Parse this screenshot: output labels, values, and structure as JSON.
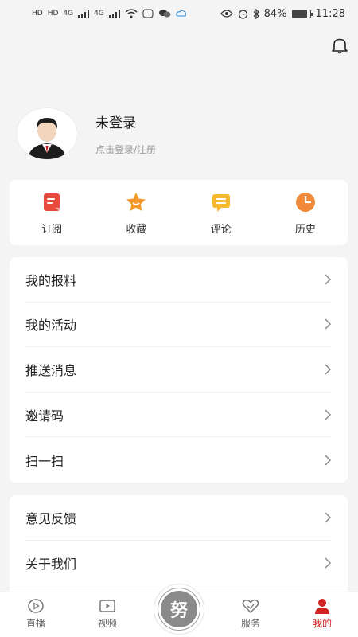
{
  "status_bar": {
    "left_labels": [
      "HD",
      "HD",
      "4G",
      "4G"
    ],
    "battery": "84%",
    "battery_level": 0.84,
    "time": "11:28"
  },
  "header": {
    "bell_icon": "bell-icon"
  },
  "profile": {
    "name": "未登录",
    "subtitle": "点击登录/注册"
  },
  "quick_actions": [
    {
      "label": "订阅",
      "icon": "subscribe-icon",
      "color": "#e84a3c"
    },
    {
      "label": "收藏",
      "icon": "favorite-star-icon",
      "color": "#f59a2a"
    },
    {
      "label": "评论",
      "icon": "comment-icon",
      "color": "#f5b82e"
    },
    {
      "label": "历史",
      "icon": "history-clock-icon",
      "color": "#f08a3a"
    }
  ],
  "menu_primary": [
    {
      "label": "我的报料"
    },
    {
      "label": "我的活动"
    },
    {
      "label": "推送消息"
    },
    {
      "label": "邀请码"
    },
    {
      "label": "扫一扫"
    }
  ],
  "menu_secondary": [
    {
      "label": "意见反馈"
    },
    {
      "label": "关于我们"
    }
  ],
  "bottom_nav": {
    "items": [
      {
        "label": "直播",
        "icon": "live-play-icon"
      },
      {
        "label": "视频",
        "icon": "video-icon"
      },
      {
        "label": "服务",
        "icon": "service-heart-icon"
      },
      {
        "label": "我的",
        "icon": "profile-icon",
        "active": true
      }
    ],
    "center_logo": "努",
    "active_color": "#d22222"
  }
}
